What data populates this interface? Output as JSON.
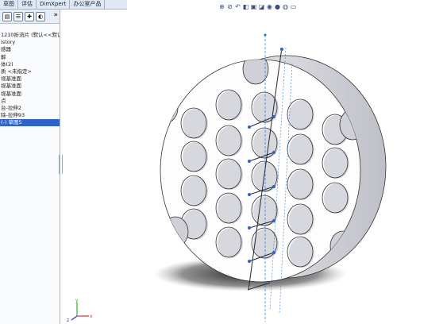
{
  "command_manager": {
    "tabs": [
      "草图",
      "评估",
      "DimXpert",
      "办公室产品"
    ]
  },
  "feature_tree": {
    "expand_label": "»",
    "items": [
      "1210折流片 (默认<<默认>",
      "istory",
      "感器",
      "解",
      "体(2)",
      "质 <未指定>",
      "视基准面",
      "视基准面",
      "视基准面",
      "点",
      "台-拉伸2",
      "除-拉伸93",
      "(-) 草图5"
    ],
    "selected_index": 12
  },
  "view_toolbar": {
    "icons": [
      "zoom-fit-icon",
      "zoom-area-icon",
      "previous-view-icon",
      "section-view-icon",
      "view-orientation-icon",
      "display-style-icon",
      "hide-show-icon",
      "edit-appearance-icon",
      "apply-scene-icon",
      "view-settings-icon"
    ]
  },
  "triad": {
    "x_label": "x",
    "y_label": "y",
    "z_label": "z"
  }
}
